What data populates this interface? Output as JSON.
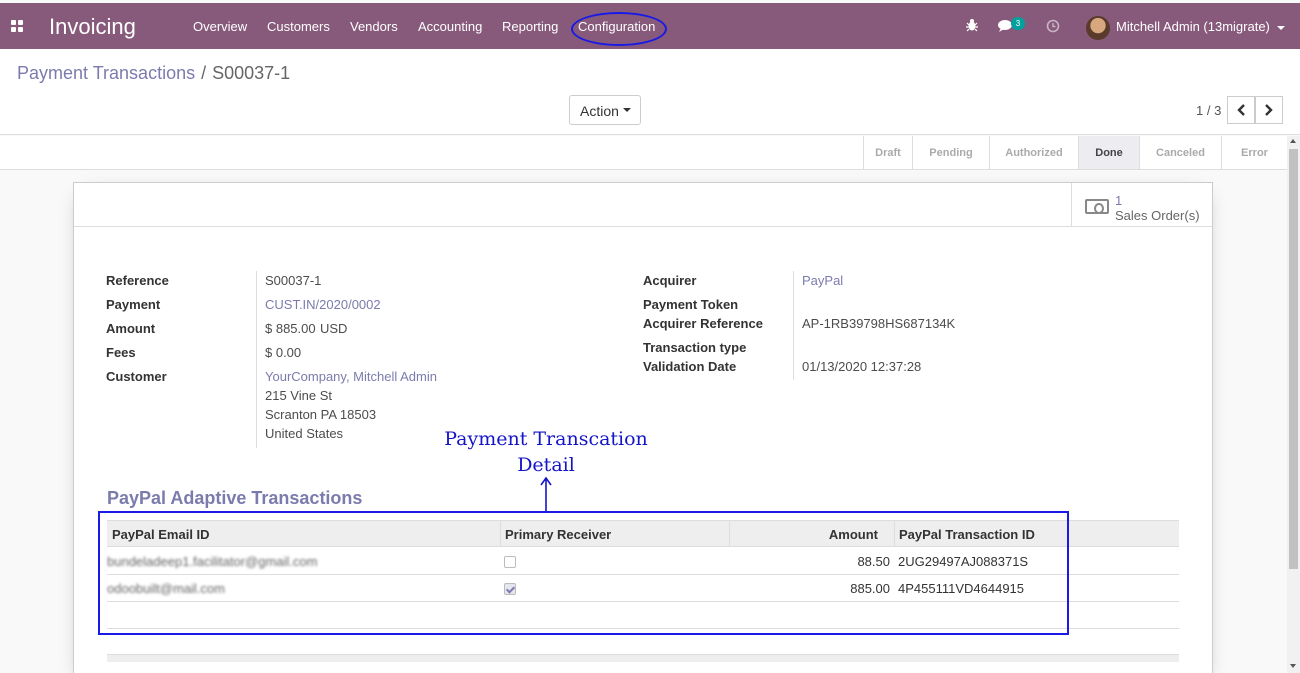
{
  "navbar": {
    "app_title": "Invoicing",
    "menu": [
      "Overview",
      "Customers",
      "Vendors",
      "Accounting",
      "Reporting",
      "Configuration"
    ],
    "messages_badge": "3",
    "user_name": "Mitchell Admin (13migrate)",
    "icons": [
      "apps-icon",
      "bug-icon",
      "chat-icon",
      "clock-icon",
      "avatar",
      "chevron-down-icon"
    ]
  },
  "breadcrumb": {
    "parent": "Payment Transactions",
    "separator": "/",
    "current": "S00037-1"
  },
  "toolbar": {
    "action_label": "Action",
    "pager_value": "1 / 3"
  },
  "status_steps": [
    "Draft",
    "Pending",
    "Authorized",
    "Done",
    "Canceled",
    "Error"
  ],
  "status_current": "Done",
  "smart_button": {
    "count": "1",
    "label": "Sales Order(s)",
    "icon": "money-icon"
  },
  "fields_left": {
    "reference_label": "Reference",
    "reference_value": "S00037-1",
    "payment_label": "Payment",
    "payment_value": "CUST.IN/2020/0002",
    "amount_label": "Amount",
    "amount_value": "$ 885.00",
    "currency_value": "USD",
    "fees_label": "Fees",
    "fees_value": "$ 0.00",
    "customer_label": "Customer",
    "customer_name": "YourCompany, Mitchell Admin",
    "address_line1": "215 Vine St",
    "address_line2": "Scranton PA 18503",
    "address_line3": "United States"
  },
  "fields_right": {
    "acquirer_label": "Acquirer",
    "acquirer_value": "PayPal",
    "payment_token_label": "Payment Token",
    "payment_token_value": "",
    "acquirer_reference_label": "Acquirer Reference",
    "acquirer_reference_value": "AP-1RB39798HS687134K",
    "transaction_type_label": "Transaction type",
    "transaction_type_value": "",
    "validation_date_label": "Validation Date",
    "validation_date_value": "01/13/2020 12:37:28"
  },
  "annotation": {
    "line1": "Payment  Transcation",
    "line2": "Detail"
  },
  "section": {
    "title": "PayPal Adaptive Transactions",
    "columns": [
      "PayPal Email ID",
      "Primary Receiver",
      "Amount",
      "PayPal Transaction ID"
    ],
    "rows": [
      {
        "email": "bundeladeep1.facilitator@gmail.com",
        "primary": false,
        "amount": "88.50",
        "txn_id": "2UG29497AJ088371S"
      },
      {
        "email": "odoobuilt@mail.com",
        "primary": true,
        "amount": "885.00",
        "txn_id": "4P455111VD4644915"
      }
    ]
  },
  "colors": {
    "navbar": "#875a7b",
    "link": "#7c7bad",
    "annotation": "#1515c8"
  }
}
